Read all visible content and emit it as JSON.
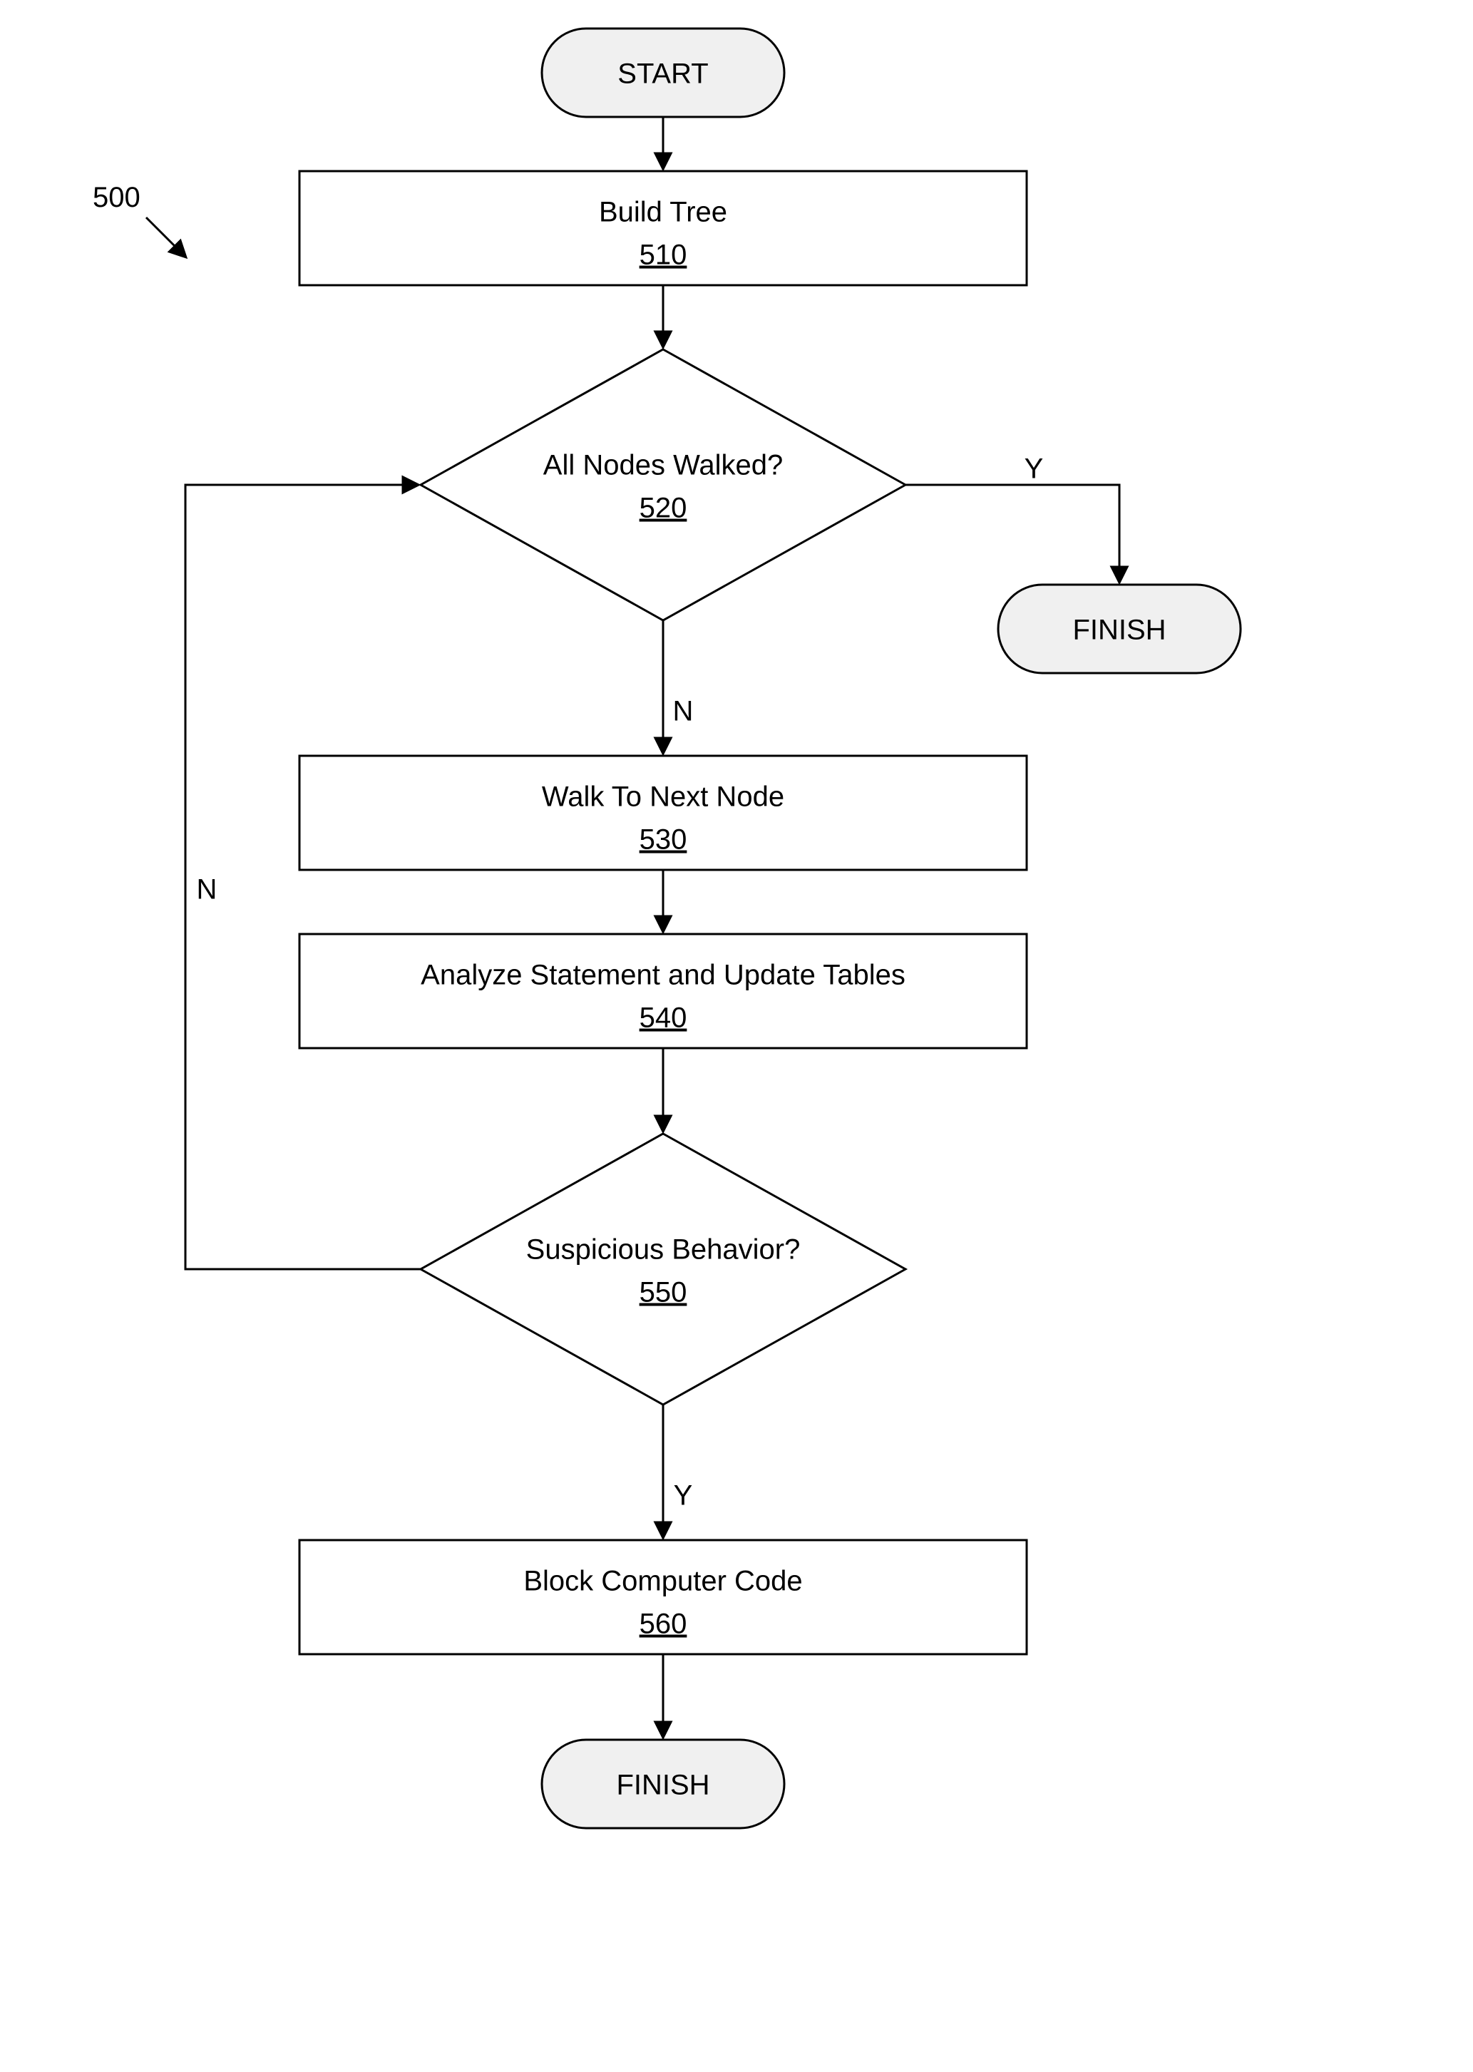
{
  "figure_ref": "500",
  "terminals": {
    "start": "START",
    "finish_yes": "FINISH",
    "finish_bottom": "FINISH"
  },
  "processes": {
    "build_tree": {
      "label": "Build Tree",
      "ref": "510"
    },
    "walk_next": {
      "label": "Walk To Next Node",
      "ref": "530"
    },
    "analyze": {
      "label": "Analyze Statement and Update Tables",
      "ref": "540"
    },
    "block_code": {
      "label": "Block Computer Code",
      "ref": "560"
    }
  },
  "decisions": {
    "all_walked": {
      "label": "All Nodes Walked?",
      "ref": "520"
    },
    "suspicious": {
      "label": "Suspicious Behavior?",
      "ref": "550"
    }
  },
  "branches": {
    "yes": "Y",
    "no": "N"
  }
}
